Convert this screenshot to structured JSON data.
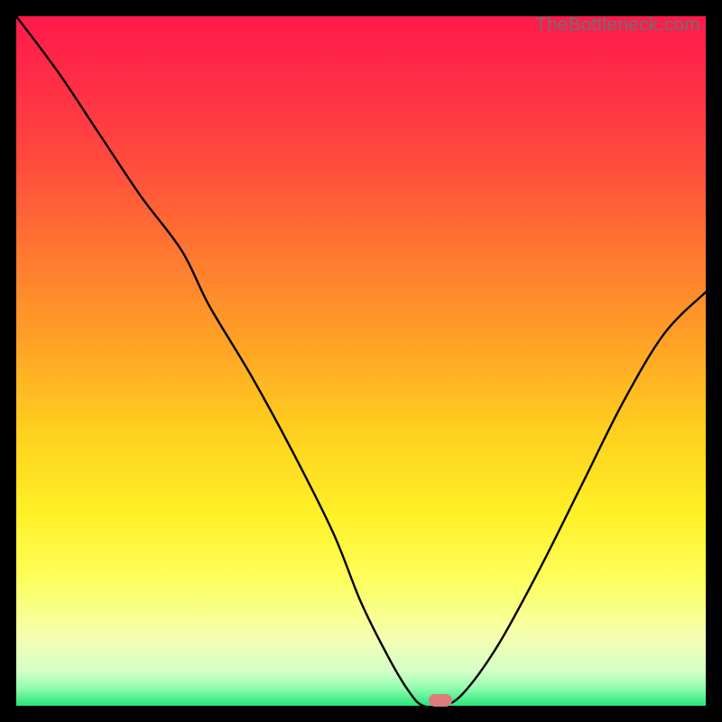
{
  "watermark": "TheBottleneck.com",
  "marker": {
    "color": "#dd7b7b",
    "x_frac": 0.615,
    "y_frac": 0.992
  },
  "chart_data": {
    "type": "line",
    "title": "",
    "xlabel": "",
    "ylabel": "",
    "xlim": [
      0,
      100
    ],
    "ylim": [
      0,
      100
    ],
    "series": [
      {
        "name": "bottleneck-curve",
        "x": [
          0,
          6,
          12,
          18,
          24,
          28,
          34,
          40,
          46,
          50,
          54,
          57,
          59,
          62,
          65,
          70,
          76,
          82,
          88,
          94,
          100
        ],
        "y": [
          100,
          92,
          83,
          74,
          66,
          58,
          48,
          37,
          25,
          15,
          7,
          2,
          0,
          0,
          2,
          9,
          20,
          32,
          44,
          54,
          60
        ]
      }
    ],
    "background_gradient": {
      "stops": [
        {
          "pos": 0.0,
          "color": "#ff1a4b"
        },
        {
          "pos": 0.1,
          "color": "#ff2e46"
        },
        {
          "pos": 0.22,
          "color": "#ff4e3c"
        },
        {
          "pos": 0.35,
          "color": "#ff7a30"
        },
        {
          "pos": 0.48,
          "color": "#ffa425"
        },
        {
          "pos": 0.6,
          "color": "#ffcf1f"
        },
        {
          "pos": 0.72,
          "color": "#fff026"
        },
        {
          "pos": 0.82,
          "color": "#fdff5e"
        },
        {
          "pos": 0.9,
          "color": "#f4ffb0"
        },
        {
          "pos": 0.95,
          "color": "#d6ffc8"
        },
        {
          "pos": 0.975,
          "color": "#8dfcae"
        },
        {
          "pos": 1.0,
          "color": "#28e47a"
        }
      ]
    }
  }
}
